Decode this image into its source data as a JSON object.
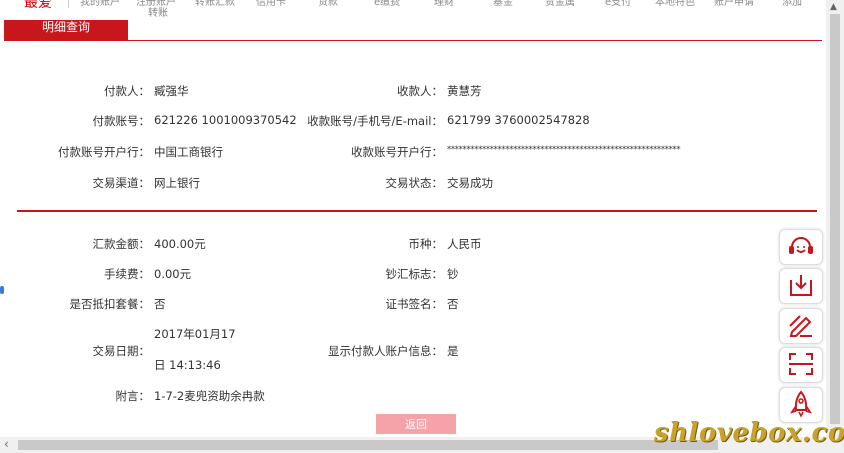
{
  "nav": {
    "logo": "最爱",
    "items": [
      "我的账户",
      "注册账户",
      "转账汇款",
      "信用卡",
      "贷款",
      "e缴费",
      "理财",
      "基金",
      "贵金属",
      "e支付",
      "本地特色",
      "账户申请",
      "添加"
    ],
    "sub_item": "转账"
  },
  "tab": {
    "label": "明细查询"
  },
  "payment": {
    "payer_label": "付款人：",
    "payer": "臧强华",
    "payee_label": "收款人：",
    "payee": "黄慧芳",
    "payer_account_label": "付款账号：",
    "payer_account": "621226 1001009370542",
    "payee_account_label": "收款账号/手机号/E-mail：",
    "payee_account": "621799 3760002547828",
    "payer_bank_label": "付款账号开户行：",
    "payer_bank": "中国工商银行",
    "payee_bank_label": "收款账号开户行：",
    "payee_bank": "************************************************************",
    "channel_label": "交易渠道：",
    "channel": "网上银行",
    "status_label": "交易状态：",
    "status": "交易成功"
  },
  "detail": {
    "amount_label": "汇款金额：",
    "amount": "400.00元",
    "currency_label": "币种：",
    "currency": "人民币",
    "fee_label": "手续费：",
    "fee": "0.00元",
    "cash_label": "钞汇标志：",
    "cash": "钞",
    "package_label": "是否抵扣套餐：",
    "package": "否",
    "cert_label": "证书签名：",
    "cert": "否",
    "date_label": "交易日期：",
    "date_line1": "2017年01月17",
    "date_line2": "日 14:13:46",
    "show_info_label": "显示付款人账户信息：",
    "show_info": "是",
    "note_label": "附言：",
    "note": "1-7-2麦兜资助余冉款"
  },
  "buttons": {
    "back": "返回"
  },
  "sidebar": {
    "icons": [
      "headset-icon",
      "download-icon",
      "edit-icon",
      "scan-icon",
      "rocket-icon"
    ]
  },
  "watermark": "shlovebox.com",
  "colors": {
    "accent": "#c8161d",
    "button_disabled": "#f5a3a8",
    "watermark": "#c8a22a"
  }
}
